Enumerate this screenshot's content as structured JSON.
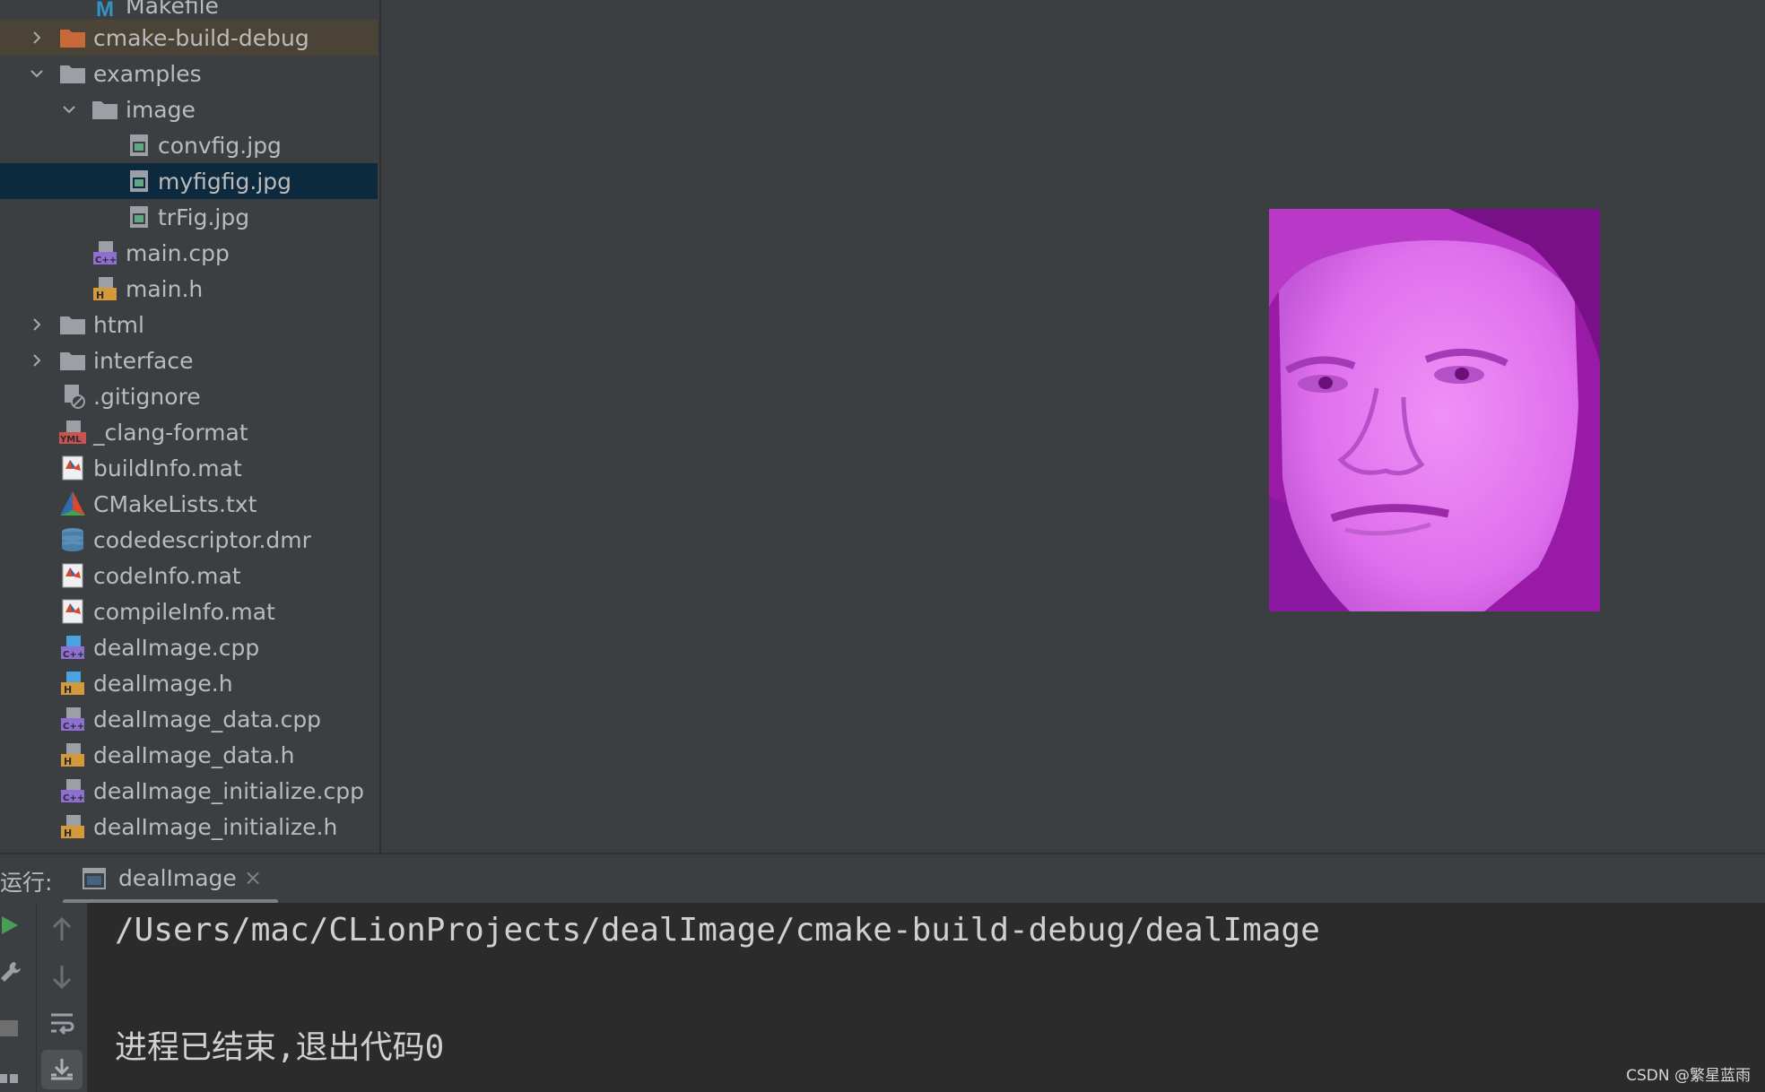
{
  "tree": {
    "rows": [
      {
        "label": "Makefile",
        "icon": "makefile-icon",
        "depth": 2,
        "chevron": "none"
      },
      {
        "label": "cmake-build-debug",
        "icon": "folder-orange-icon",
        "depth": 1,
        "chevron": "right"
      },
      {
        "label": "examples",
        "icon": "folder-icon",
        "depth": 1,
        "chevron": "down"
      },
      {
        "label": "image",
        "icon": "folder-icon",
        "depth": 2,
        "chevron": "down"
      },
      {
        "label": "convfig.jpg",
        "icon": "image-file-icon",
        "depth": 3,
        "chevron": "none"
      },
      {
        "label": "myfigfig.jpg",
        "icon": "image-file-icon",
        "depth": 3,
        "chevron": "none"
      },
      {
        "label": "trFig.jpg",
        "icon": "image-file-icon",
        "depth": 3,
        "chevron": "none"
      },
      {
        "label": "main.cpp",
        "icon": "cpp-file-icon",
        "depth": 2,
        "chevron": "none"
      },
      {
        "label": "main.h",
        "icon": "header-file-icon",
        "depth": 2,
        "chevron": "none"
      },
      {
        "label": "html",
        "icon": "folder-icon",
        "depth": 1,
        "chevron": "right"
      },
      {
        "label": "interface",
        "icon": "folder-icon",
        "depth": 1,
        "chevron": "right"
      },
      {
        "label": ".gitignore",
        "icon": "gitignore-file-icon",
        "depth": 1,
        "chevron": "none"
      },
      {
        "label": "_clang-format",
        "icon": "yml-file-icon",
        "depth": 1,
        "chevron": "none"
      },
      {
        "label": "buildInfo.mat",
        "icon": "matlab-file-icon",
        "depth": 1,
        "chevron": "none"
      },
      {
        "label": "CMakeLists.txt",
        "icon": "cmake-icon",
        "depth": 1,
        "chevron": "none"
      },
      {
        "label": "codedescriptor.dmr",
        "icon": "database-icon",
        "depth": 1,
        "chevron": "none"
      },
      {
        "label": "codeInfo.mat",
        "icon": "matlab-file-icon",
        "depth": 1,
        "chevron": "none"
      },
      {
        "label": "compileInfo.mat",
        "icon": "matlab-file-icon",
        "depth": 1,
        "chevron": "none"
      },
      {
        "label": "dealImage.cpp",
        "icon": "cpp-file-icon",
        "depth": 1,
        "chevron": "none"
      },
      {
        "label": "dealImage.h",
        "icon": "header-file-icon",
        "depth": 1,
        "chevron": "none"
      },
      {
        "label": "dealImage_data.cpp",
        "icon": "cpp-file-icon",
        "depth": 1,
        "chevron": "none"
      },
      {
        "label": "dealImage_data.h",
        "icon": "header-file-icon",
        "depth": 1,
        "chevron": "none"
      },
      {
        "label": "dealImage_initialize.cpp",
        "icon": "cpp-file-icon",
        "depth": 1,
        "chevron": "none"
      },
      {
        "label": "dealImage_initialize.h",
        "icon": "header-file-icon",
        "depth": 1,
        "chevron": "none"
      }
    ]
  },
  "run": {
    "label": "运行:",
    "tab_label": "dealImage",
    "tab_close": "×"
  },
  "console": {
    "lines": [
      "/Users/mac/CLionProjects/dealImage/cmake-build-debug/dealImage",
      "进程已结束,退出代码0"
    ]
  },
  "watermark": "CSDN @繁星蓝雨",
  "colors": {
    "background": "#3c3f41",
    "console_bg": "#2b2b2b",
    "selected_row": "#0d293e",
    "excluded_dir_row": "#4b4436",
    "face_magenta": "#e070f0"
  }
}
